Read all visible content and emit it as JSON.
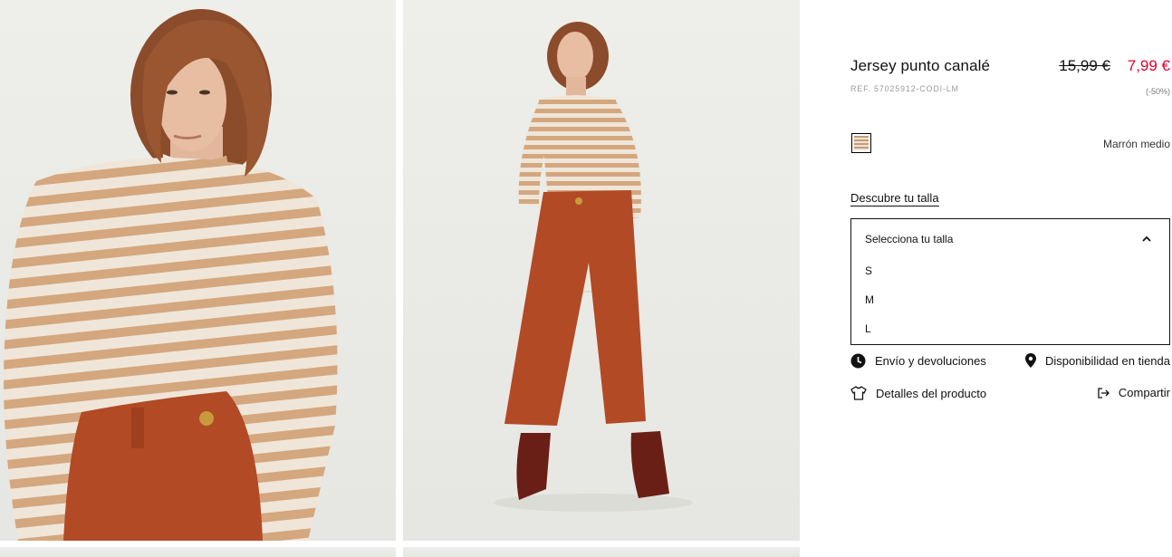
{
  "product": {
    "title": "Jersey punto canalé",
    "ref": "REF. 57025912-CODI-LM",
    "old_price": "15,99 €",
    "new_price": "7,99 €",
    "discount": "(-50%)",
    "sale_color": "#e4002b"
  },
  "color": {
    "name": "Marrón medio",
    "swatch_icon": "stripe-swatch"
  },
  "size": {
    "guide_label": "Descubre tu talla",
    "select_placeholder": "Selecciona tu talla",
    "options": [
      "S",
      "M",
      "L"
    ]
  },
  "links": {
    "shipping": "Envío y devoluciones",
    "store": "Disponibilidad en tienda",
    "details": "Detalles del producto",
    "share": "Compartir"
  },
  "icons": {
    "shipping": "clock-icon",
    "store": "location-pin-icon",
    "details": "tshirt-icon",
    "share": "share-icon",
    "dropdown": "chevron-up-icon"
  }
}
